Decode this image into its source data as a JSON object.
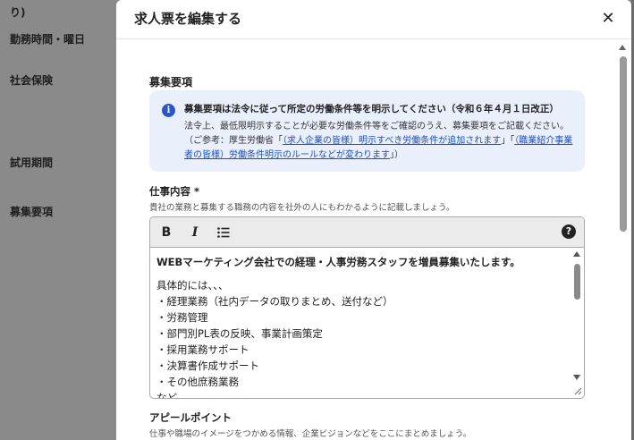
{
  "backdrop": {
    "labels": [
      "り)",
      "勤務時間・曜日",
      "社会保険",
      "試用期間",
      "募集要項"
    ]
  },
  "modal": {
    "title": "求人票を編集する",
    "close_glyph": "✕"
  },
  "section": {
    "title": "募集要項"
  },
  "notice": {
    "icon_glyph": "i",
    "heading": "募集要項は法令に従って所定の労働条件等を明示してください（令和６年４月１日改正）",
    "text_before": "法令上、最低限明示することが必要な労働条件等をご確認のうえ、募集要項をご記載ください。（ご参考：厚生労働省「",
    "link1": "（求人企業の皆様）明示すべき労働条件が追加されます",
    "text_middle": "」「",
    "link2": "（職業紹介事業者の皆様）労働条件明示のルールなどが変わります",
    "text_after": "」）"
  },
  "job_description": {
    "label": "仕事内容 *",
    "help": "貴社の業務と募集する職務の内容を社外の人にもわかるように記載しましょう。",
    "toolbar": {
      "bold_glyph": "B",
      "italic_glyph": "I",
      "list_glyph": "☰",
      "help_glyph": "?"
    },
    "lines": [
      "WEBマーケティング会社での経理・人事労務スタッフを増員募集いたします。",
      "具体的には、、、",
      "・経理業務（社内データの取りまとめ、送付など）",
      "・労務管理",
      "・部門別PL表の反映、事業計画策定",
      "・採用業務サポート",
      "・決算書作成サポート",
      "・その他庶務業務",
      "など"
    ]
  },
  "appeal": {
    "label": "アピールポイント",
    "help": "仕事や職場のイメージをつかめる情報、企業ビジョンなどをここにまとめましょう。"
  }
}
